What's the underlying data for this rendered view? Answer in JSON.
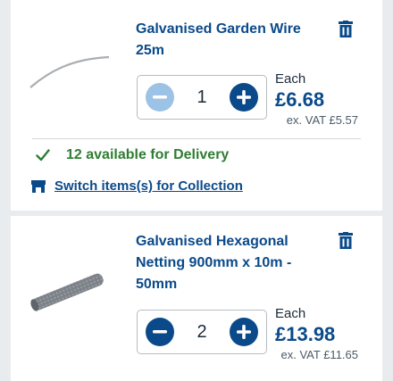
{
  "items": [
    {
      "name": "Galvanised Garden Wire 25m",
      "title_lines": [
        "Galvanised Garden Wire",
        "25m"
      ],
      "quantity": "1",
      "each_label": "Each",
      "price": "£6.68",
      "ex_vat": "ex. VAT £5.57",
      "minus_enabled": false,
      "thumbnail_icon": "garden-wire-image"
    },
    {
      "name": "Galvanised Hexagonal Netting 900mm x 10m - 50mm",
      "title_lines": [
        "Galvanised Hexagonal",
        "Netting 900mm x 10m -",
        "50mm"
      ],
      "quantity": "2",
      "each_label": "Each",
      "price": "£13.98",
      "ex_vat": "ex. VAT £11.65",
      "minus_enabled": true,
      "thumbnail_icon": "hexagonal-netting-image"
    }
  ],
  "delivery": {
    "text": "12 available for Delivery",
    "icon": "check-icon",
    "color": "#2e7d32"
  },
  "collection": {
    "link_text": "Switch items(s) for Collection",
    "icon": "store-icon"
  },
  "colors": {
    "brand": "#0a4a8a",
    "disabled_button": "#9cc2e6",
    "background": "#e9ecef"
  }
}
